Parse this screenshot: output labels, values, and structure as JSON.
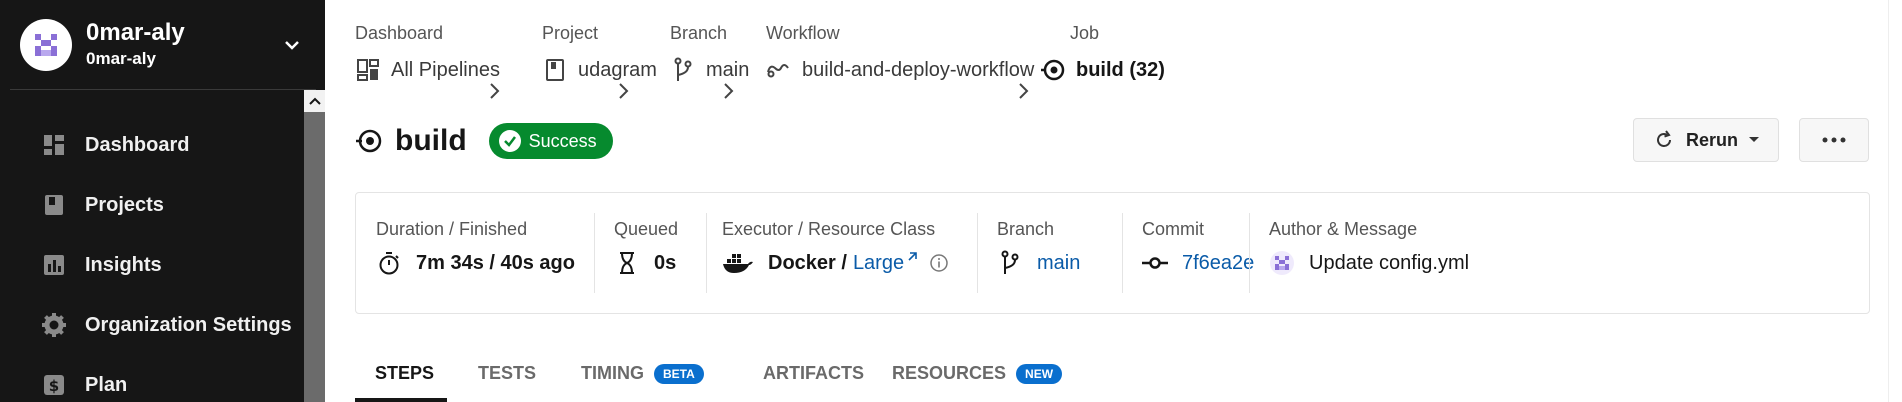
{
  "org": {
    "name": "0mar-aly",
    "sub": "0mar-aly"
  },
  "nav": [
    {
      "label": "Dashboard",
      "icon": "dashboard-icon"
    },
    {
      "label": "Projects",
      "icon": "projects-icon"
    },
    {
      "label": "Insights",
      "icon": "insights-icon"
    },
    {
      "label": "Organization Settings",
      "icon": "gear-icon"
    },
    {
      "label": "Plan",
      "icon": "plan-icon"
    }
  ],
  "breadcrumbs": [
    {
      "caption": "Dashboard",
      "value": "All Pipelines",
      "icon": "pipelines-icon"
    },
    {
      "caption": "Project",
      "value": "udagram",
      "icon": "project-icon"
    },
    {
      "caption": "Branch",
      "value": "main",
      "icon": "branch-icon"
    },
    {
      "caption": "Workflow",
      "value": "build-and-deploy-workflow",
      "icon": "workflow-icon"
    },
    {
      "caption": "Job",
      "value": "build (32)",
      "icon": "job-icon"
    }
  ],
  "job": {
    "title": "build",
    "status": "Success"
  },
  "actions": {
    "rerun": "Rerun",
    "more": "more-icon"
  },
  "info": {
    "duration_caption": "Duration / Finished",
    "duration_value": "7m 34s / 40s ago",
    "queued_caption": "Queued",
    "queued_value": "0s",
    "executor_caption": "Executor / Resource Class",
    "executor_value": "Docker /",
    "resource_class": "Large",
    "branch_caption": "Branch",
    "branch_value": "main",
    "commit_caption": "Commit",
    "commit_value": "7f6ea2e",
    "author_caption": "Author & Message",
    "author_message": "Update config.yml"
  },
  "tabs": [
    {
      "label": "STEPS"
    },
    {
      "label": "TESTS"
    },
    {
      "label": "TIMING",
      "pill": "BETA"
    },
    {
      "label": "ARTIFACTS"
    },
    {
      "label": "RESOURCES",
      "pill": "NEW"
    }
  ],
  "colors": {
    "success": "#068a2e",
    "link": "#0a5ba8",
    "sidebar": "#161616",
    "pill": "#0a6fce"
  }
}
